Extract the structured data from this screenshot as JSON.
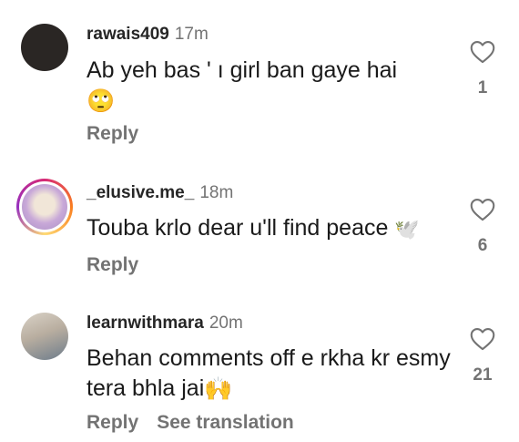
{
  "comments": [
    {
      "username": "rawais409",
      "time": "17m",
      "text": "Ab yeh bas ' ı girl ban gaye hai",
      "emoji": "🙄",
      "likes": "1",
      "actions": [
        "Reply"
      ]
    },
    {
      "username": "_elusive.me_",
      "time": "18m",
      "text": "Touba krlo dear u'll find peace",
      "emoji": "🕊️",
      "likes": "6",
      "actions": [
        "Reply"
      ]
    },
    {
      "username": "learnwithmara",
      "time": "20m",
      "text": "Behan comments off e rkha kr esmy tera bhla jai",
      "emoji": "🙌",
      "likes": "21",
      "actions": [
        "Reply",
        "See translation"
      ]
    }
  ]
}
